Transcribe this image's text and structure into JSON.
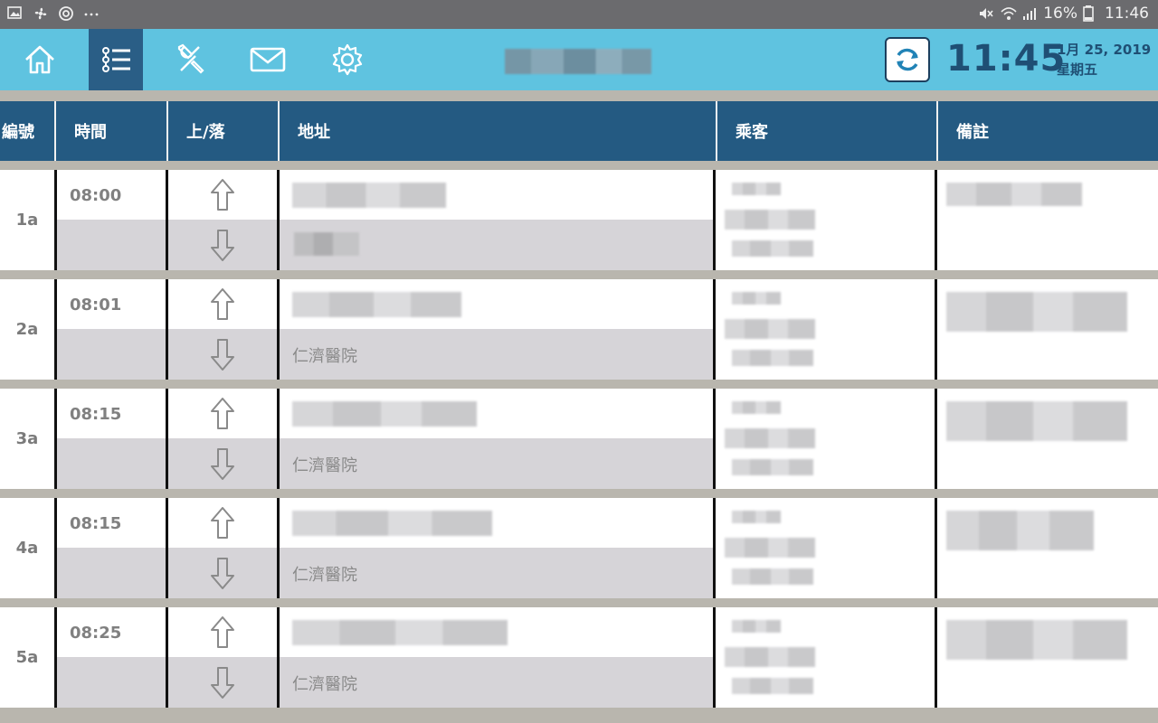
{
  "status_bar": {
    "battery_percent": "16%",
    "time": "11:46"
  },
  "toolbar": {
    "clock": "11:45",
    "date_line1": "1月 25, 2019",
    "date_line2": "星期五"
  },
  "table": {
    "headers": [
      "編號",
      "時間",
      "上/落",
      "地址",
      "乘客",
      "備註"
    ],
    "rows": [
      {
        "id": "1a",
        "time": "08:00",
        "dropoff_address": ""
      },
      {
        "id": "2a",
        "time": "08:01",
        "dropoff_address": "仁濟醫院"
      },
      {
        "id": "3a",
        "time": "08:15",
        "dropoff_address": "仁濟醫院"
      },
      {
        "id": "4a",
        "time": "08:15",
        "dropoff_address": "仁濟醫院"
      },
      {
        "id": "5a",
        "time": "08:25",
        "dropoff_address": "仁濟醫院"
      }
    ]
  },
  "colors": {
    "toolbar_bg": "#5fc3e0",
    "active_tab_bg": "#2a5e86",
    "header_bg": "#245a82",
    "clock_text": "#1f4f74"
  },
  "icons": {
    "toolbar": [
      "home-icon",
      "task-list-icon",
      "tools-icon",
      "mail-icon",
      "gear-icon",
      "sync-icon"
    ],
    "status_bar": [
      "image-icon",
      "fan-icon",
      "sync-circle-icon",
      "more-icon",
      "mute-icon",
      "wifi-icon",
      "signal-icon",
      "battery-icon"
    ]
  }
}
